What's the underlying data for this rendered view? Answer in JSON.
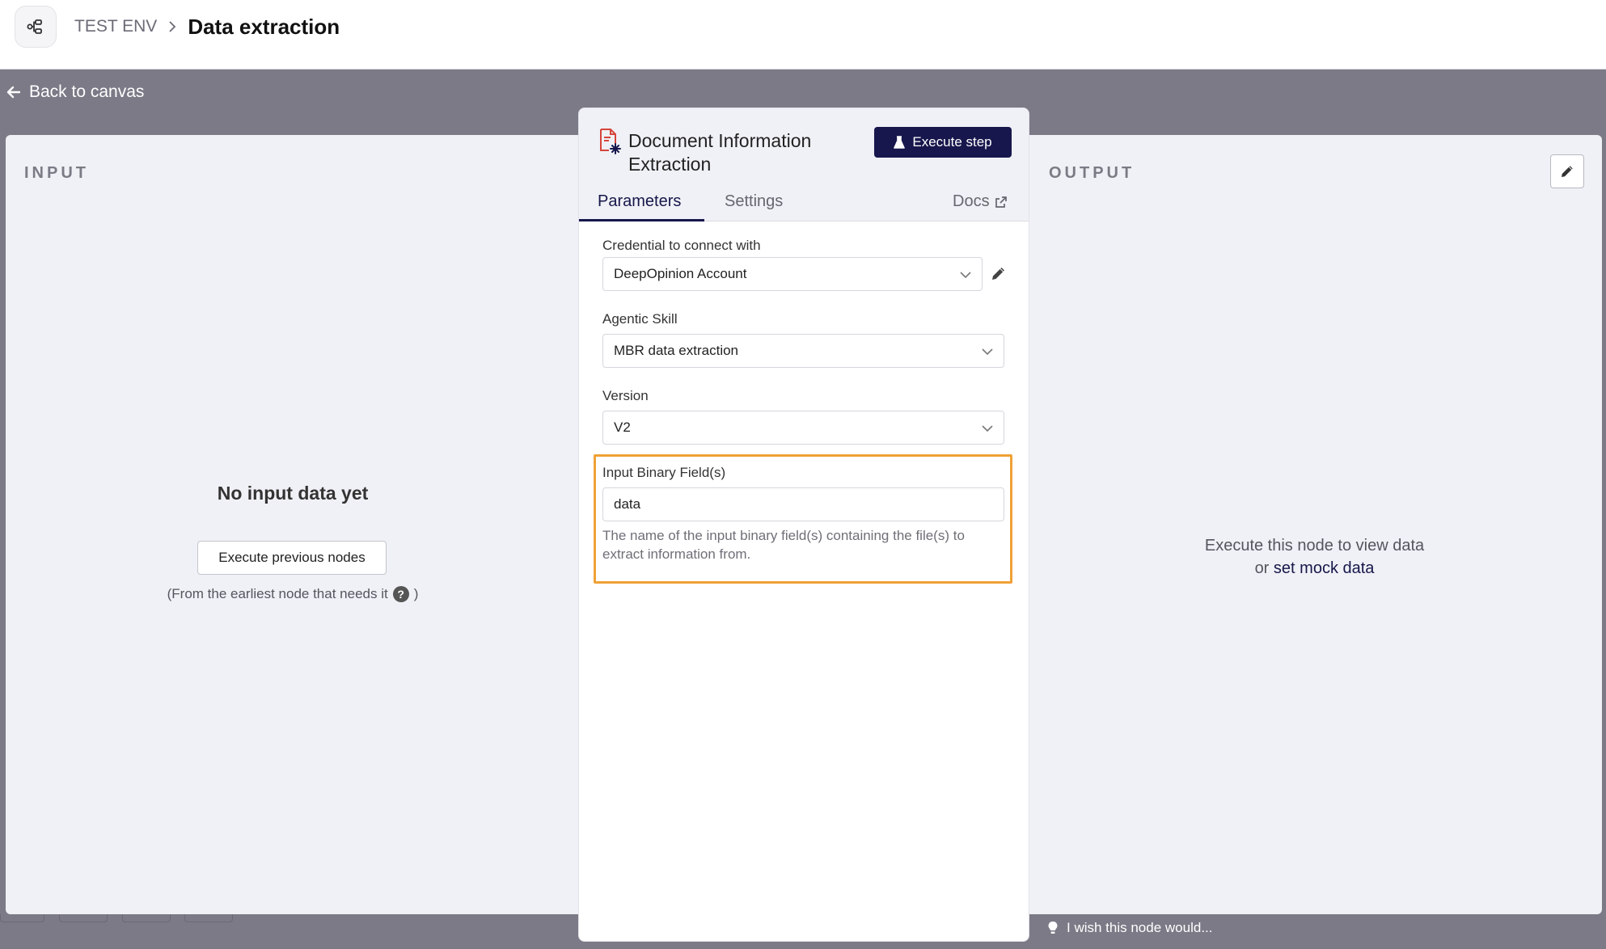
{
  "header": {
    "environment": "TEST ENV",
    "workflow_title": "Data extraction"
  },
  "back_link": "Back to canvas",
  "input_panel": {
    "heading": "INPUT",
    "empty_title": "No input data yet",
    "execute_previous_label": "Execute previous nodes",
    "hint": "(From the earliest node that needs it",
    "hint_close": ")"
  },
  "node": {
    "title": "Document Information Extraction",
    "execute_step_label": "Execute step",
    "tabs": {
      "parameters": "Parameters",
      "settings": "Settings",
      "docs": "Docs"
    },
    "fields": {
      "credential": {
        "label": "Credential to connect with",
        "value": "DeepOpinion Account"
      },
      "skill": {
        "label": "Agentic Skill",
        "value": "MBR data extraction"
      },
      "version": {
        "label": "Version",
        "value": "V2"
      },
      "binary": {
        "label": "Input Binary Field(s)",
        "value": "data",
        "hint": "The name of the input binary field(s) containing the file(s) to extract information from."
      }
    }
  },
  "output_panel": {
    "heading": "OUTPUT",
    "empty_line1": "Execute this node to view data",
    "empty_or": "or",
    "mock_link": "set mock data"
  },
  "feedback": "I wish this node would...",
  "colors": {
    "accent": "#17174d",
    "highlight": "#f0a136",
    "backdrop": "#7b7a86",
    "panel_bg": "#f0f1f6"
  }
}
